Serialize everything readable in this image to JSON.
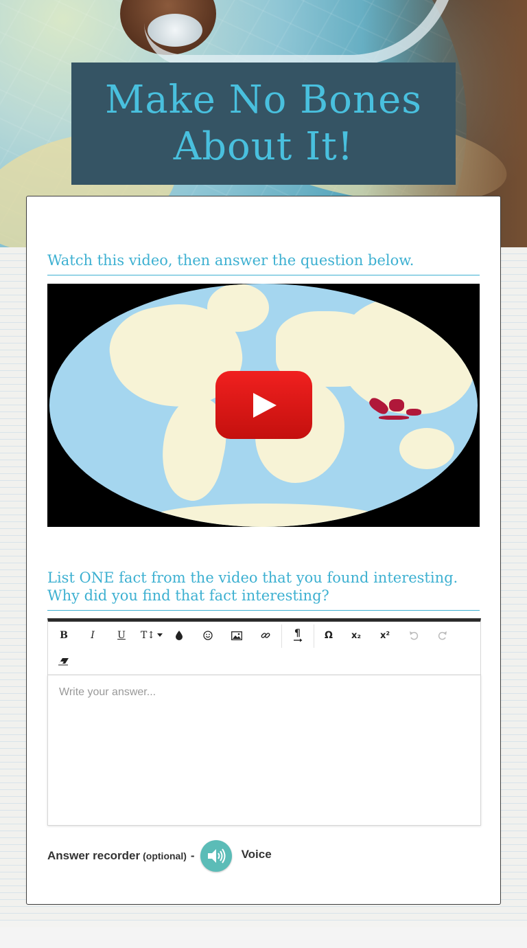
{
  "header": {
    "title_line1": "Make No Bones",
    "title_line2": "About It!"
  },
  "question1": {
    "prompt": "Watch this video, then answer the question below."
  },
  "video": {
    "play_icon": "youtube-play-icon"
  },
  "question2": {
    "prompt_line1": "List ONE fact from the video that you found interesting.",
    "prompt_line2": "Why did you find that fact interesting?"
  },
  "toolbar": {
    "bold": "B",
    "italic": "I",
    "underline": "U",
    "font_size": "T↕",
    "special_chars": "Ω",
    "subscript": "x₂",
    "superscript": "x²"
  },
  "editor": {
    "placeholder": "Write your answer..."
  },
  "recorder": {
    "label": "Answer recorder",
    "optional": "(optional)",
    "dash": "-",
    "voice": "Voice"
  },
  "colors": {
    "accent": "#3db0d1",
    "title_bg": "#355464",
    "title_text": "#49c0de",
    "play_red": "#e62117",
    "mic_teal": "#5bbcb7"
  }
}
